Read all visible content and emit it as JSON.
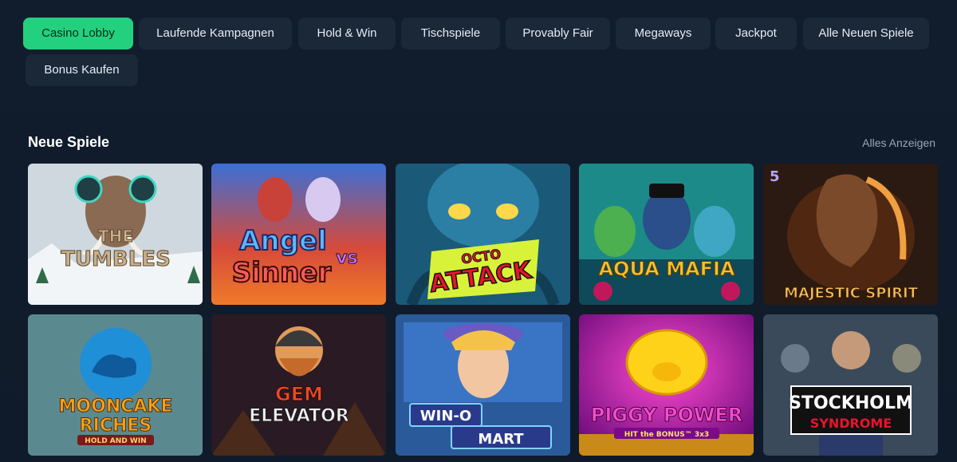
{
  "tabs": [
    {
      "label": "Casino Lobby",
      "active": true
    },
    {
      "label": "Laufende Kampagnen",
      "active": false
    },
    {
      "label": "Hold & Win",
      "active": false
    },
    {
      "label": "Tischspiele",
      "active": false
    },
    {
      "label": "Provably Fair",
      "active": false
    },
    {
      "label": "Megaways",
      "active": false
    },
    {
      "label": "Jackpot",
      "active": false
    },
    {
      "label": "Alle Neuen Spiele",
      "active": false
    },
    {
      "label": "Bonus Kaufen",
      "active": false
    }
  ],
  "section": {
    "title": "Neue Spiele",
    "see_all": "Alles Anzeigen"
  },
  "games": [
    {
      "title_lines": [
        "THE",
        "TUMBLES"
      ]
    },
    {
      "title_lines": [
        "Angel",
        "Sinner"
      ],
      "badge": "vs"
    },
    {
      "title_lines": [
        "OCTO",
        "ATTACK"
      ]
    },
    {
      "title_lines": [
        "AQUA MAFIA"
      ]
    },
    {
      "title_lines": [
        "MAJESTIC SPIRIT"
      ],
      "badge": "5"
    },
    {
      "title_lines": [
        "MOONCAKE",
        "RICHES"
      ],
      "subtitle": "HOLD AND WIN"
    },
    {
      "title_lines": [
        "GEM",
        "ELEVATOR"
      ]
    },
    {
      "title_lines": [
        "WIN-O",
        "MART"
      ]
    },
    {
      "title_lines": [
        "PIGGY POWER"
      ],
      "subtitle": "HIT the BONUS™ 3x3"
    },
    {
      "title_lines": [
        "STOCKHOLM",
        "SYNDROME"
      ]
    }
  ],
  "colors": {
    "accent": "#23d07e",
    "background": "#0f1b2a",
    "tab": "#1a2838"
  }
}
